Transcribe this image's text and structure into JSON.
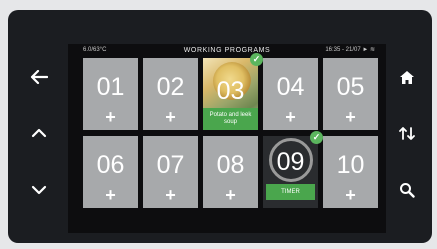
{
  "status": {
    "left": "6.0/63°C",
    "title": "WORKING PROGRAMS",
    "right": "16:35 - 21/07 ► ≋"
  },
  "tiles": [
    {
      "num": "01",
      "plus": "+"
    },
    {
      "num": "02",
      "plus": "+"
    },
    {
      "num": "03",
      "label": "Potato and leek soup",
      "checked": true
    },
    {
      "num": "04",
      "plus": "+"
    },
    {
      "num": "05",
      "plus": "+"
    },
    {
      "num": "06",
      "plus": "+"
    },
    {
      "num": "07",
      "plus": "+"
    },
    {
      "num": "08",
      "plus": "+"
    },
    {
      "num": "09",
      "label": "TIMER",
      "checked": true
    },
    {
      "num": "10",
      "plus": "+"
    }
  ],
  "icons": {
    "back": "left-arrow-icon",
    "up": "chevron-up-icon",
    "down": "chevron-down-icon",
    "home": "home-icon",
    "sort": "sort-icon",
    "search": "search-icon"
  },
  "colors": {
    "tile_bg": "#a7a9ab",
    "active_green": "#4aa64d",
    "screen_bg": "#0d0d0f"
  }
}
